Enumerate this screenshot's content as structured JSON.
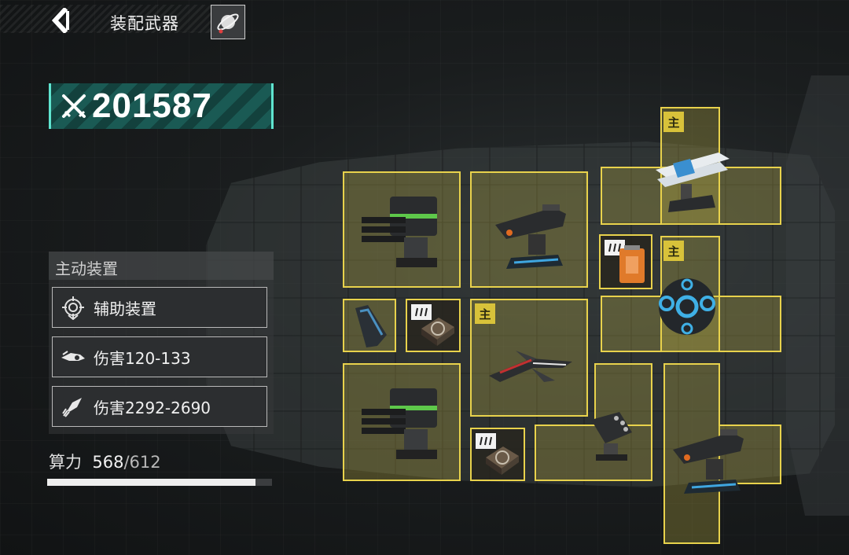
{
  "header": {
    "title": "装配武器"
  },
  "power": {
    "value": "201587"
  },
  "panel": {
    "heading": "主动装置",
    "slots": [
      {
        "label": "辅助装置",
        "icon": "gear-emblem-icon"
      },
      {
        "label": "伤害120-133",
        "icon": "wing-drone-icon"
      },
      {
        "label": "伤害2292-2690",
        "icon": "missile-icon"
      }
    ]
  },
  "compute": {
    "label": "算力",
    "used": "568",
    "sep_total": "/612",
    "fraction": 0.928
  },
  "grid": {
    "main_tag": "主"
  },
  "colors": {
    "cell_border": "#e8d24c",
    "power_accent": "#5fe4cf",
    "power_bg": "#1a5a54"
  }
}
